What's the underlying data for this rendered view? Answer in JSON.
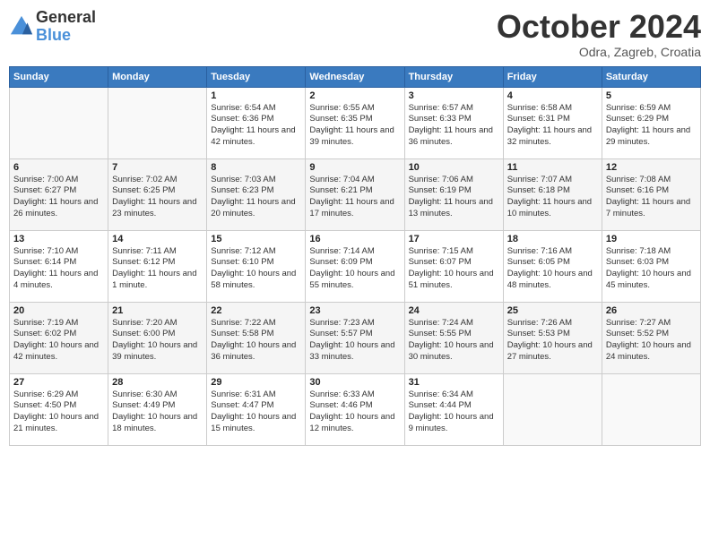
{
  "header": {
    "logo_line1": "General",
    "logo_line2": "Blue",
    "month": "October 2024",
    "location": "Odra, Zagreb, Croatia"
  },
  "weekdays": [
    "Sunday",
    "Monday",
    "Tuesday",
    "Wednesday",
    "Thursday",
    "Friday",
    "Saturday"
  ],
  "weeks": [
    [
      {
        "day": "",
        "sunrise": "",
        "sunset": "",
        "daylight": ""
      },
      {
        "day": "",
        "sunrise": "",
        "sunset": "",
        "daylight": ""
      },
      {
        "day": "1",
        "sunrise": "Sunrise: 6:54 AM",
        "sunset": "Sunset: 6:36 PM",
        "daylight": "Daylight: 11 hours and 42 minutes."
      },
      {
        "day": "2",
        "sunrise": "Sunrise: 6:55 AM",
        "sunset": "Sunset: 6:35 PM",
        "daylight": "Daylight: 11 hours and 39 minutes."
      },
      {
        "day": "3",
        "sunrise": "Sunrise: 6:57 AM",
        "sunset": "Sunset: 6:33 PM",
        "daylight": "Daylight: 11 hours and 36 minutes."
      },
      {
        "day": "4",
        "sunrise": "Sunrise: 6:58 AM",
        "sunset": "Sunset: 6:31 PM",
        "daylight": "Daylight: 11 hours and 32 minutes."
      },
      {
        "day": "5",
        "sunrise": "Sunrise: 6:59 AM",
        "sunset": "Sunset: 6:29 PM",
        "daylight": "Daylight: 11 hours and 29 minutes."
      }
    ],
    [
      {
        "day": "6",
        "sunrise": "Sunrise: 7:00 AM",
        "sunset": "Sunset: 6:27 PM",
        "daylight": "Daylight: 11 hours and 26 minutes."
      },
      {
        "day": "7",
        "sunrise": "Sunrise: 7:02 AM",
        "sunset": "Sunset: 6:25 PM",
        "daylight": "Daylight: 11 hours and 23 minutes."
      },
      {
        "day": "8",
        "sunrise": "Sunrise: 7:03 AM",
        "sunset": "Sunset: 6:23 PM",
        "daylight": "Daylight: 11 hours and 20 minutes."
      },
      {
        "day": "9",
        "sunrise": "Sunrise: 7:04 AM",
        "sunset": "Sunset: 6:21 PM",
        "daylight": "Daylight: 11 hours and 17 minutes."
      },
      {
        "day": "10",
        "sunrise": "Sunrise: 7:06 AM",
        "sunset": "Sunset: 6:19 PM",
        "daylight": "Daylight: 11 hours and 13 minutes."
      },
      {
        "day": "11",
        "sunrise": "Sunrise: 7:07 AM",
        "sunset": "Sunset: 6:18 PM",
        "daylight": "Daylight: 11 hours and 10 minutes."
      },
      {
        "day": "12",
        "sunrise": "Sunrise: 7:08 AM",
        "sunset": "Sunset: 6:16 PM",
        "daylight": "Daylight: 11 hours and 7 minutes."
      }
    ],
    [
      {
        "day": "13",
        "sunrise": "Sunrise: 7:10 AM",
        "sunset": "Sunset: 6:14 PM",
        "daylight": "Daylight: 11 hours and 4 minutes."
      },
      {
        "day": "14",
        "sunrise": "Sunrise: 7:11 AM",
        "sunset": "Sunset: 6:12 PM",
        "daylight": "Daylight: 11 hours and 1 minute."
      },
      {
        "day": "15",
        "sunrise": "Sunrise: 7:12 AM",
        "sunset": "Sunset: 6:10 PM",
        "daylight": "Daylight: 10 hours and 58 minutes."
      },
      {
        "day": "16",
        "sunrise": "Sunrise: 7:14 AM",
        "sunset": "Sunset: 6:09 PM",
        "daylight": "Daylight: 10 hours and 55 minutes."
      },
      {
        "day": "17",
        "sunrise": "Sunrise: 7:15 AM",
        "sunset": "Sunset: 6:07 PM",
        "daylight": "Daylight: 10 hours and 51 minutes."
      },
      {
        "day": "18",
        "sunrise": "Sunrise: 7:16 AM",
        "sunset": "Sunset: 6:05 PM",
        "daylight": "Daylight: 10 hours and 48 minutes."
      },
      {
        "day": "19",
        "sunrise": "Sunrise: 7:18 AM",
        "sunset": "Sunset: 6:03 PM",
        "daylight": "Daylight: 10 hours and 45 minutes."
      }
    ],
    [
      {
        "day": "20",
        "sunrise": "Sunrise: 7:19 AM",
        "sunset": "Sunset: 6:02 PM",
        "daylight": "Daylight: 10 hours and 42 minutes."
      },
      {
        "day": "21",
        "sunrise": "Sunrise: 7:20 AM",
        "sunset": "Sunset: 6:00 PM",
        "daylight": "Daylight: 10 hours and 39 minutes."
      },
      {
        "day": "22",
        "sunrise": "Sunrise: 7:22 AM",
        "sunset": "Sunset: 5:58 PM",
        "daylight": "Daylight: 10 hours and 36 minutes."
      },
      {
        "day": "23",
        "sunrise": "Sunrise: 7:23 AM",
        "sunset": "Sunset: 5:57 PM",
        "daylight": "Daylight: 10 hours and 33 minutes."
      },
      {
        "day": "24",
        "sunrise": "Sunrise: 7:24 AM",
        "sunset": "Sunset: 5:55 PM",
        "daylight": "Daylight: 10 hours and 30 minutes."
      },
      {
        "day": "25",
        "sunrise": "Sunrise: 7:26 AM",
        "sunset": "Sunset: 5:53 PM",
        "daylight": "Daylight: 10 hours and 27 minutes."
      },
      {
        "day": "26",
        "sunrise": "Sunrise: 7:27 AM",
        "sunset": "Sunset: 5:52 PM",
        "daylight": "Daylight: 10 hours and 24 minutes."
      }
    ],
    [
      {
        "day": "27",
        "sunrise": "Sunrise: 6:29 AM",
        "sunset": "Sunset: 4:50 PM",
        "daylight": "Daylight: 10 hours and 21 minutes."
      },
      {
        "day": "28",
        "sunrise": "Sunrise: 6:30 AM",
        "sunset": "Sunset: 4:49 PM",
        "daylight": "Daylight: 10 hours and 18 minutes."
      },
      {
        "day": "29",
        "sunrise": "Sunrise: 6:31 AM",
        "sunset": "Sunset: 4:47 PM",
        "daylight": "Daylight: 10 hours and 15 minutes."
      },
      {
        "day": "30",
        "sunrise": "Sunrise: 6:33 AM",
        "sunset": "Sunset: 4:46 PM",
        "daylight": "Daylight: 10 hours and 12 minutes."
      },
      {
        "day": "31",
        "sunrise": "Sunrise: 6:34 AM",
        "sunset": "Sunset: 4:44 PM",
        "daylight": "Daylight: 10 hours and 9 minutes."
      },
      {
        "day": "",
        "sunrise": "",
        "sunset": "",
        "daylight": ""
      },
      {
        "day": "",
        "sunrise": "",
        "sunset": "",
        "daylight": ""
      }
    ]
  ]
}
